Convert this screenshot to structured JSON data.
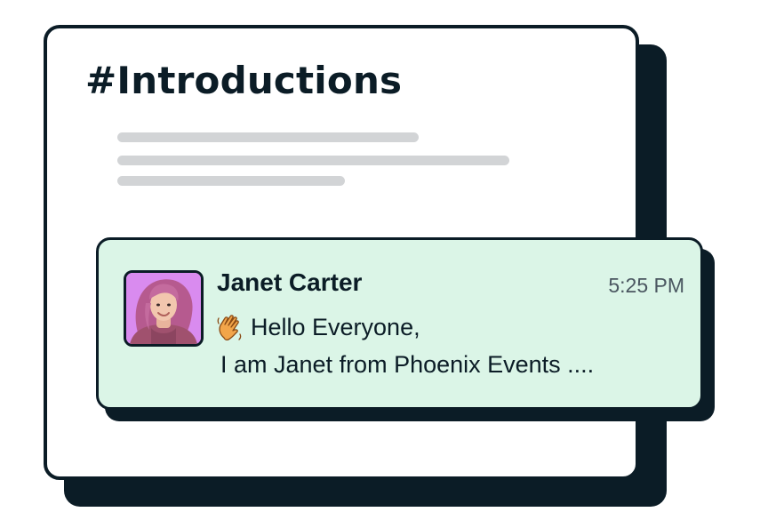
{
  "channel": {
    "title": "#Introductions"
  },
  "message": {
    "author": "Janet Carter",
    "timestamp": "5:25 PM",
    "line1": "Hello Everyone,",
    "line2": "I am Janet from Phoenix Events ....",
    "reaction_icon": "waving-hand-icon",
    "avatar_icon": "user-avatar"
  },
  "colors": {
    "dark": "#0b1c26",
    "message_bg": "#dbf5e7",
    "placeholder": "#d2d4d6",
    "avatar_bg": "#dc8ff0"
  }
}
